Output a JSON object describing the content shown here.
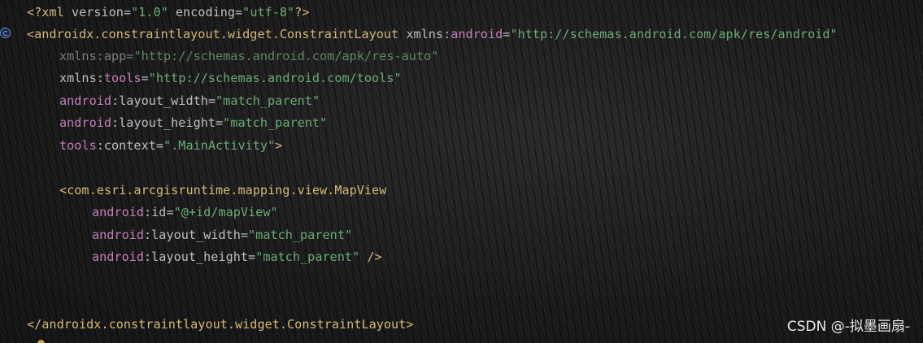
{
  "code": {
    "line1": {
      "open": "<?xml",
      "a1": " version=",
      "v1": "\"1.0\"",
      "a2": " encoding=",
      "v2": "\"utf-8\"",
      "close": "?>"
    },
    "line2": {
      "tag": "<androidx.constraintlayout.widget.ConstraintLayout",
      "attr": " xmlns:",
      "ns": "android",
      "eq": "=",
      "val": "\"http://schemas.android.com/apk/res/android\""
    },
    "line3": {
      "attr": "xmlns:app=",
      "val": "\"http://schemas.android.com/apk/res-auto\""
    },
    "line4": {
      "attr": "xmlns:",
      "ns": "tools",
      "eq": "=",
      "val": "\"http://schemas.android.com/tools\""
    },
    "line5": {
      "ns": "android",
      "attr": ":layout_width=",
      "val": "\"match_parent\""
    },
    "line6": {
      "ns": "android",
      "attr": ":layout_height=",
      "val": "\"match_parent\""
    },
    "line7": {
      "ns": "tools",
      "attr": ":context=",
      "val": "\".MainActivity\"",
      "close": ">"
    },
    "line9": {
      "tag": "<com.esri.arcgisruntime.mapping.view.MapView"
    },
    "line10": {
      "ns": "android",
      "attr": ":id=",
      "val": "\"@+id/mapView\""
    },
    "line11": {
      "ns": "android",
      "attr": ":layout_width=",
      "val": "\"match_parent\""
    },
    "line12": {
      "ns": "android",
      "attr": ":layout_height=",
      "val": "\"match_parent\"",
      "close": " />"
    },
    "line15": {
      "tag": "</androidx.constraintlayout.widget.ConstraintLayout>"
    }
  },
  "watermark": "CSDN @-拟墨画扇-",
  "icons": {
    "gutter": "class-reference-icon",
    "gutter_bottom": "intention-bulb-icon"
  },
  "colors": {
    "tag": "#d5b778",
    "namespace": "#c77dbb",
    "string": "#6aab73",
    "text": "#bcbec4"
  }
}
